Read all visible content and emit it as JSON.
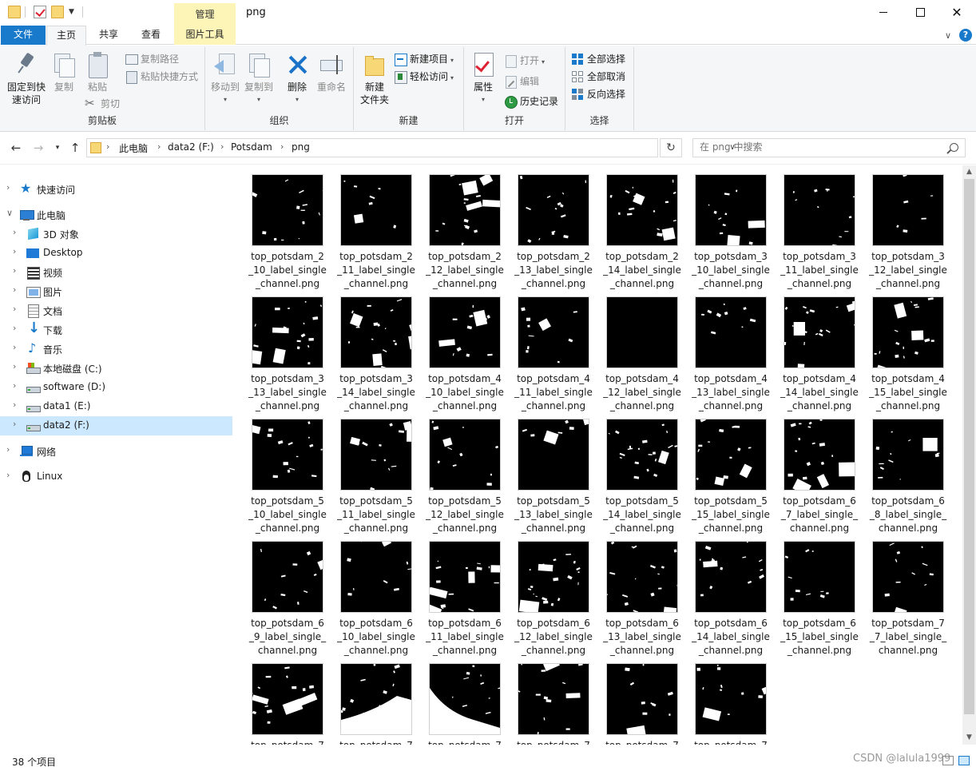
{
  "window": {
    "title": "png",
    "context_tab": "管理",
    "controls": {
      "minimize": "—",
      "maximize": "☐",
      "close": "✕"
    }
  },
  "ribbon_tabs": {
    "file": "文件",
    "home": "主页",
    "share": "共享",
    "view": "查看",
    "picture_tools": "图片工具",
    "help": "?"
  },
  "ribbon": {
    "clipboard": {
      "label": "剪贴板",
      "pin": "固定到快\n速访问",
      "copy": "复制",
      "paste": "粘贴",
      "copy_path": "复制路径",
      "paste_shortcut": "粘贴快捷方式",
      "cut": "剪切"
    },
    "organize": {
      "label": "组织",
      "move_to": "移动到",
      "copy_to": "复制到",
      "delete": "删除",
      "rename": "重命名"
    },
    "new": {
      "label": "新建",
      "new_folder": "新建\n文件夹",
      "new_item": "新建项目",
      "easy_access": "轻松访问"
    },
    "open": {
      "label": "打开",
      "properties": "属性",
      "open": "打开",
      "edit": "编辑",
      "history": "历史记录"
    },
    "select": {
      "label": "选择",
      "select_all": "全部选择",
      "select_none": "全部取消",
      "invert": "反向选择"
    }
  },
  "address": {
    "breadcrumbs": [
      "此电脑",
      "data2 (F:)",
      "Potsdam",
      "png"
    ],
    "search_placeholder": "在 png 中搜索"
  },
  "nav_tree": [
    {
      "label": "快速访问",
      "icon": "star-icon",
      "level": 0,
      "expanded": false,
      "selected": false
    },
    {
      "label": "此电脑",
      "icon": "computer-icon",
      "level": 0,
      "expanded": true,
      "selected": false
    },
    {
      "label": "3D 对象",
      "icon": "3d-objects-icon",
      "level": 1,
      "expanded": false,
      "selected": false
    },
    {
      "label": "Desktop",
      "icon": "desktop-icon",
      "level": 1,
      "expanded": false,
      "selected": false
    },
    {
      "label": "视频",
      "icon": "video-icon",
      "level": 1,
      "expanded": false,
      "selected": false
    },
    {
      "label": "图片",
      "icon": "pictures-icon",
      "level": 1,
      "expanded": false,
      "selected": false
    },
    {
      "label": "文档",
      "icon": "documents-icon",
      "level": 1,
      "expanded": false,
      "selected": false
    },
    {
      "label": "下载",
      "icon": "downloads-icon",
      "level": 1,
      "expanded": false,
      "selected": false
    },
    {
      "label": "音乐",
      "icon": "music-icon",
      "level": 1,
      "expanded": false,
      "selected": false
    },
    {
      "label": "本地磁盘 (C:)",
      "icon": "system-drive-icon",
      "level": 1,
      "expanded": false,
      "selected": false
    },
    {
      "label": "software (D:)",
      "icon": "drive-icon",
      "level": 1,
      "expanded": false,
      "selected": false
    },
    {
      "label": "data1 (E:)",
      "icon": "drive-icon",
      "level": 1,
      "expanded": false,
      "selected": false
    },
    {
      "label": "data2 (F:)",
      "icon": "drive-icon",
      "level": 1,
      "expanded": false,
      "selected": true
    },
    {
      "label": "网络",
      "icon": "network-icon",
      "level": 0,
      "expanded": false,
      "selected": false
    },
    {
      "label": "Linux",
      "icon": "linux-icon",
      "level": 0,
      "expanded": false,
      "selected": false
    }
  ],
  "files": [
    {
      "name": "top_potsdam_2\n_10_label_single\n_channel.png"
    },
    {
      "name": "top_potsdam_2\n_11_label_single\n_channel.png"
    },
    {
      "name": "top_potsdam_2\n_12_label_single\n_channel.png"
    },
    {
      "name": "top_potsdam_2\n_13_label_single\n_channel.png"
    },
    {
      "name": "top_potsdam_2\n_14_label_single\n_channel.png"
    },
    {
      "name": "top_potsdam_3\n_10_label_single\n_channel.png"
    },
    {
      "name": "top_potsdam_3\n_11_label_single\n_channel.png"
    },
    {
      "name": "top_potsdam_3\n_12_label_single\n_channel.png"
    },
    {
      "name": "top_potsdam_3\n_13_label_single\n_channel.png"
    },
    {
      "name": "top_potsdam_3\n_14_label_single\n_channel.png"
    },
    {
      "name": "top_potsdam_4\n_10_label_single\n_channel.png"
    },
    {
      "name": "top_potsdam_4\n_11_label_single\n_channel.png"
    },
    {
      "name": "top_potsdam_4\n_12_label_single\n_channel.png"
    },
    {
      "name": "top_potsdam_4\n_13_label_single\n_channel.png"
    },
    {
      "name": "top_potsdam_4\n_14_label_single\n_channel.png"
    },
    {
      "name": "top_potsdam_4\n_15_label_single\n_channel.png"
    },
    {
      "name": "top_potsdam_5\n_10_label_single\n_channel.png"
    },
    {
      "name": "top_potsdam_5\n_11_label_single\n_channel.png"
    },
    {
      "name": "top_potsdam_5\n_12_label_single\n_channel.png"
    },
    {
      "name": "top_potsdam_5\n_13_label_single\n_channel.png"
    },
    {
      "name": "top_potsdam_5\n_14_label_single\n_channel.png"
    },
    {
      "name": "top_potsdam_5\n_15_label_single\n_channel.png"
    },
    {
      "name": "top_potsdam_6\n_7_label_single_\nchannel.png"
    },
    {
      "name": "top_potsdam_6\n_8_label_single_\nchannel.png"
    },
    {
      "name": "top_potsdam_6\n_9_label_single_\nchannel.png"
    },
    {
      "name": "top_potsdam_6\n_10_label_single\n_channel.png"
    },
    {
      "name": "top_potsdam_6\n_11_label_single\n_channel.png"
    },
    {
      "name": "top_potsdam_6\n_12_label_single\n_channel.png"
    },
    {
      "name": "top_potsdam_6\n_13_label_single\n_channel.png"
    },
    {
      "name": "top_potsdam_6\n_14_label_single\n_channel.png"
    },
    {
      "name": "top_potsdam_6\n_15_label_single\n_channel.png"
    },
    {
      "name": "top_potsdam_7\n_7_label_single_\nchannel.png"
    },
    {
      "name": "top_potsdam_7"
    },
    {
      "name": "top_potsdam_7"
    },
    {
      "name": "top_potsdam_7"
    },
    {
      "name": "top_potsdam_7"
    },
    {
      "name": "top_potsdam_7"
    },
    {
      "name": "top_potsdam_7"
    }
  ],
  "status": {
    "item_count": "38 个项目",
    "watermark": "CSDN @lalula1999"
  }
}
